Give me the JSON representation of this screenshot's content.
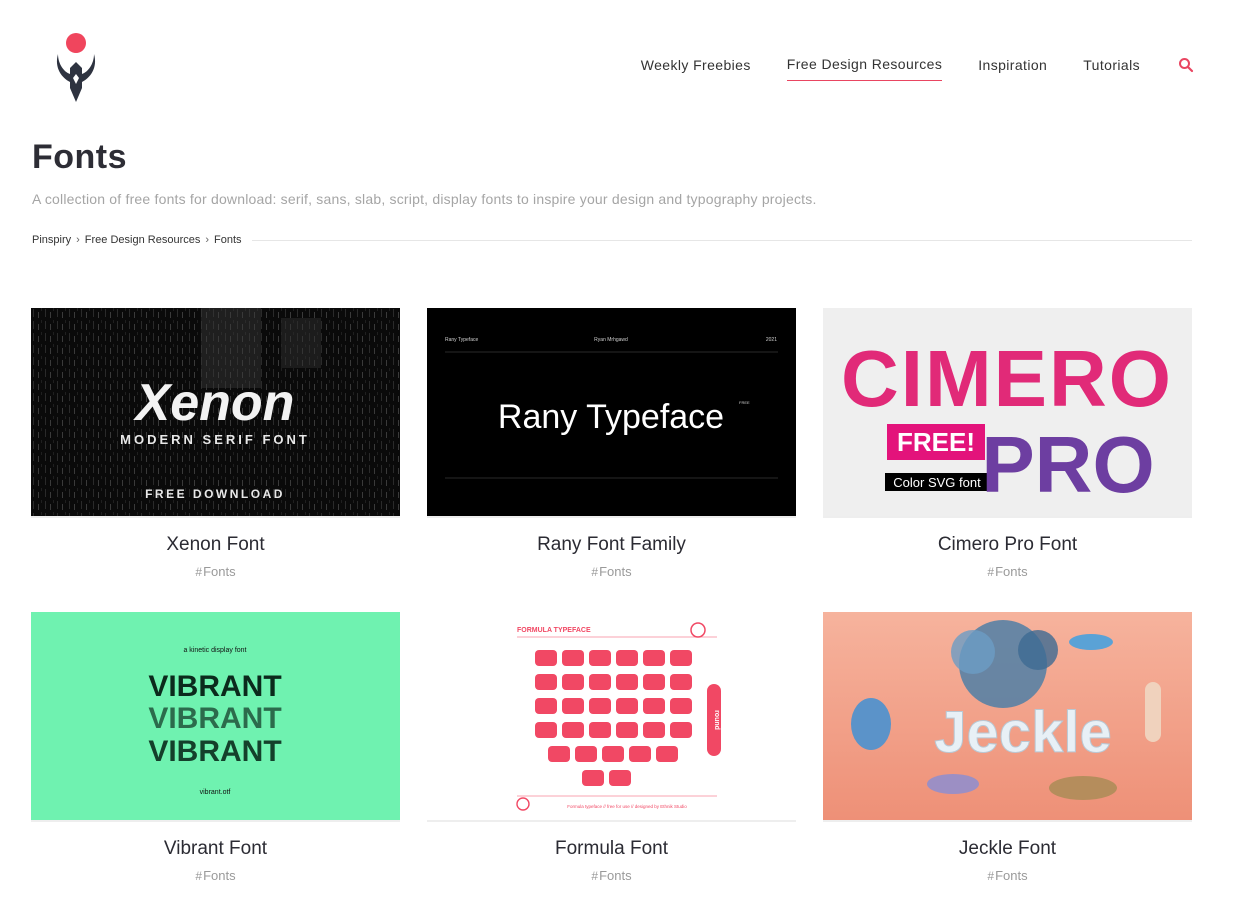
{
  "nav": {
    "items": [
      {
        "label": "Weekly Freebies"
      },
      {
        "label": "Free Design Resources",
        "active": true
      },
      {
        "label": "Inspiration"
      },
      {
        "label": "Tutorials"
      }
    ],
    "search_icon": "search-icon"
  },
  "page": {
    "title": "Fonts",
    "description": "A collection of free fonts for download: serif, sans, slab, script, display fonts to inspire your design and typography projects."
  },
  "breadcrumb": {
    "items": [
      "Pinspiry",
      "Free Design Resources",
      "Fonts"
    ],
    "separator": "›"
  },
  "cards": [
    {
      "title": "Xenon Font",
      "tag": "Fonts",
      "thumb": {
        "big": "Xenon",
        "sub": "MODERN SERIF FONT",
        "cta": "FREE DOWNLOAD"
      }
    },
    {
      "title": "Rany Font Family",
      "tag": "Fonts",
      "thumb": {
        "left": "Rany Typeface",
        "center": "Ryan Mrhgawd",
        "right": "2021",
        "big": "Rany Typeface",
        "badge": "FREE"
      }
    },
    {
      "title": "Cimero Pro Font",
      "tag": "Fonts",
      "thumb": {
        "line1": "CIMERO",
        "free": "FREE!",
        "pro": "PRO",
        "caption": "Color SVG font"
      }
    },
    {
      "title": "Vibrant Font",
      "tag": "Fonts",
      "thumb": {
        "top": "a kinetic display font",
        "word": "VIBRANT",
        "bottom": "vibrant.otf"
      }
    },
    {
      "title": "Formula Font",
      "tag": "Fonts",
      "thumb": {
        "header": "FORMULA TYPEFACE",
        "round": "round",
        "footer": "Formula typeface // free for use // designed by Ethnik Studio"
      }
    },
    {
      "title": "Jeckle Font",
      "tag": "Fonts",
      "thumb": {
        "word": "Jeckle"
      }
    }
  ],
  "colors": {
    "accent": "#e94561",
    "title": "#2d2d35",
    "muted": "#a5a5a5",
    "vibrant_bg": "#6ff2b0",
    "formula_red": "#f14864",
    "jeckle_bg": "#f3a48c"
  }
}
